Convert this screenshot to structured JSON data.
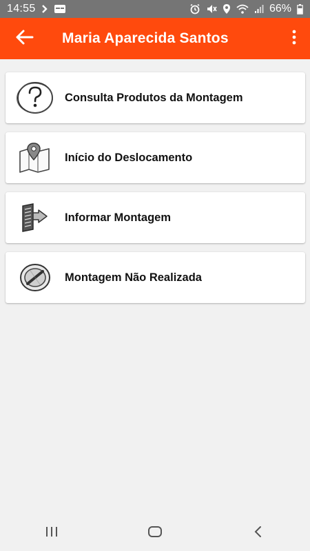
{
  "status_bar": {
    "time": "14:55",
    "battery": "66%",
    "icons": [
      "chevron-right-icon",
      "notification-card-icon",
      "alarm-icon",
      "mute-icon",
      "location-icon",
      "wifi-icon",
      "signal-icon",
      "battery-icon"
    ]
  },
  "app_bar": {
    "title": "Maria Aparecida Santos",
    "back_icon": "arrow-left-icon",
    "menu_icon": "more-vertical-icon",
    "color": "#ff4a0d"
  },
  "menu": {
    "items": [
      {
        "label": "Consulta Produtos da Montagem",
        "icon": "question-icon"
      },
      {
        "label": "Início do Deslocamento",
        "icon": "map-pin-icon"
      },
      {
        "label": "Informar Montagem",
        "icon": "report-arrow-icon"
      },
      {
        "label": "Montagem Não Realizada",
        "icon": "not-done-icon"
      }
    ]
  },
  "nav_bar": {
    "icons": [
      "recent-apps-icon",
      "home-icon",
      "back-icon"
    ]
  }
}
